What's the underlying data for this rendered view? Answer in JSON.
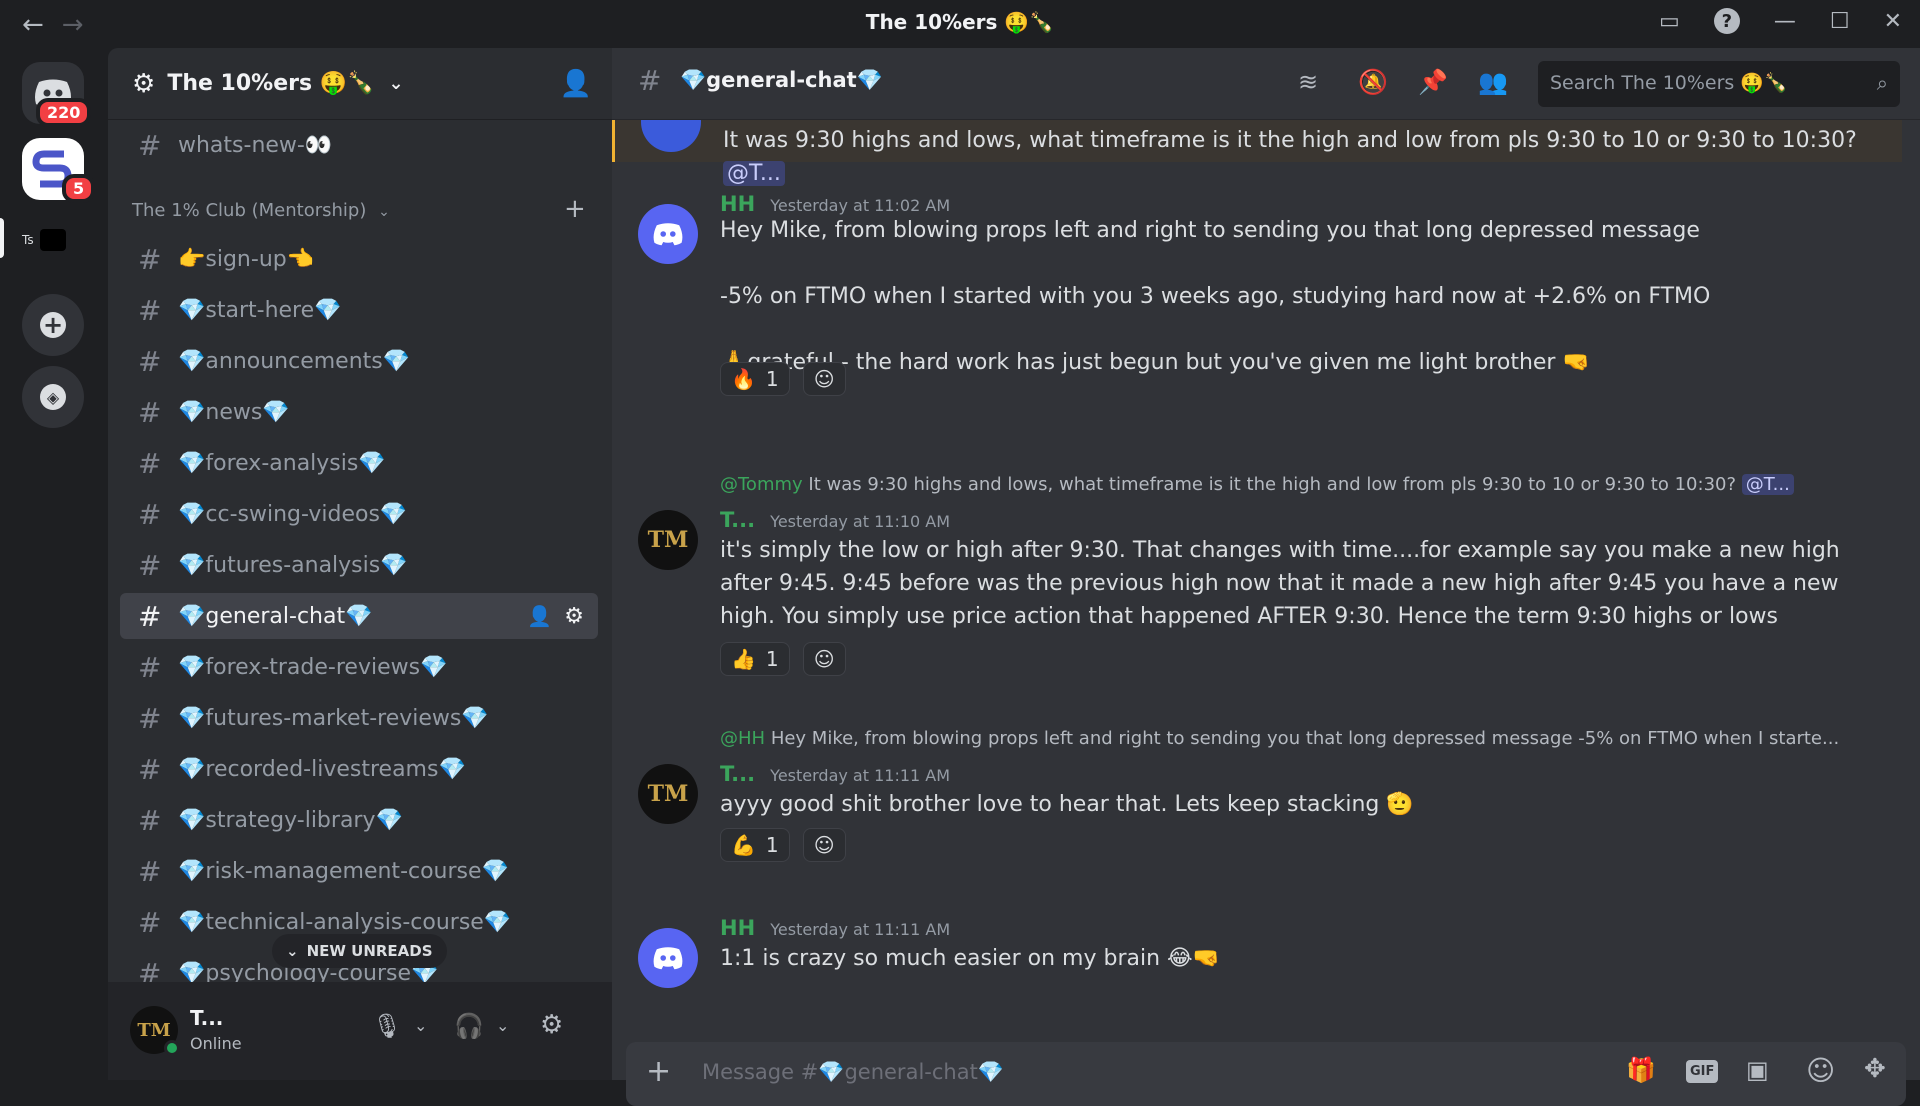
{
  "titlebar": {
    "title": "The 10%ers 🤑🍾"
  },
  "servers": {
    "home_badge": "220",
    "server_badge": "5",
    "ts_label": "Ts"
  },
  "sidebar": {
    "server_name": "The 10%ers 🤑🍾",
    "top_channel": "whats-new-👀",
    "category": "The 1% Club (Mentorship)",
    "channels": [
      "👉sign-up👈",
      "💎start-here💎",
      "💎announcements💎",
      "💎news💎",
      "💎forex-analysis💎",
      "💎cc-swing-videos💎",
      "💎futures-analysis💎",
      "💎general-chat💎",
      "💎forex-trade-reviews💎",
      "💎futures-market-reviews💎",
      "💎recorded-livestreams💎",
      "💎strategy-library💎",
      "💎risk-management-course💎",
      "💎technical-analysis-course💎",
      "💎psychology-course💎"
    ],
    "new_unreads": "NEW UNREADS"
  },
  "user": {
    "name": "T...",
    "status": "Online"
  },
  "channel": {
    "name": "💎general-chat💎",
    "search_placeholder": "Search The 10%ers 🤑🍾"
  },
  "messages": {
    "top_partial": "It was 9:30 highs and lows, what timeframe is it the high and low from pls 9:30 to 10 or 9:30 to 10:30?",
    "top_mention": "@T...",
    "m1": {
      "author": "HH",
      "time": "Yesterday at 11:02 AM",
      "line1": "Hey Mike, from blowing props left and right to sending you that long depressed message",
      "line2": "-5% on FTMO when I started with you 3 weeks ago, studying hard now at +2.6% on FTMO",
      "line3": "🙏grateful - the hard work has just begun but you've given me light brother 🤜",
      "reaction": "🔥",
      "count": "1"
    },
    "m2": {
      "reply_user": "@Tommy",
      "reply_text": "It was 9:30 highs and lows, what timeframe is it the high and low from pls 9:30 to 10 or 9:30 to 10:30?",
      "reply_mention": "@T...",
      "author": "T...",
      "time": "Yesterday at 11:10 AM",
      "text": "it's simply the low or high after 9:30. That changes with time....for example say you make a new high after 9:45. 9:45 before was the previous high now that it made a new high after 9:45 you have a new high. You simply use price action that happened AFTER 9:30. Hence the term 9:30 highs or lows",
      "reaction": "👍",
      "count": "1"
    },
    "m3": {
      "reply_user": "@HH",
      "reply_text": "Hey Mike, from blowing props left and right to sending you that long depressed message   -5% on FTMO when I starte...",
      "author": "T...",
      "time": "Yesterday at 11:11 AM",
      "text": "ayyy good shit brother love to hear that. Lets keep stacking 🫡",
      "reaction": "💪",
      "count": "1"
    },
    "m4": {
      "author": "HH",
      "time": "Yesterday at 11:11 AM",
      "text": "1:1 is crazy so much easier on my brain 😂🤜"
    }
  },
  "composer": {
    "placeholder": "Message #💎general-chat💎"
  },
  "avatar_text": "TM"
}
